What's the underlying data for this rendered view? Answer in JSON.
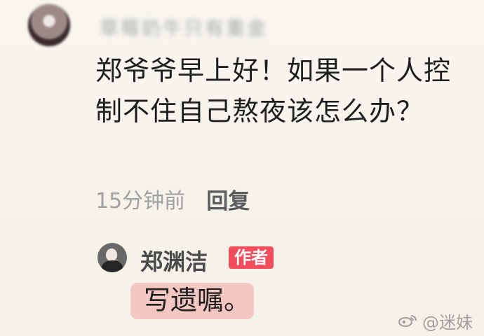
{
  "comment": {
    "username": "草莓奶牛只有重金",
    "text": "郑爷爷早上好！如果一个人控制不住自己熬夜该怎么办？",
    "time": "15分钟前",
    "reply_label": "回复"
  },
  "reply": {
    "author_name": "郑渊洁",
    "badge": "作者",
    "text": "写遗嘱。"
  },
  "watermark": {
    "text": "@迷妹",
    "icon": "weibo-icon"
  },
  "colors": {
    "background": "#f6f3ea",
    "badge": "#f14d5a",
    "highlight": "#f3bdb9"
  }
}
